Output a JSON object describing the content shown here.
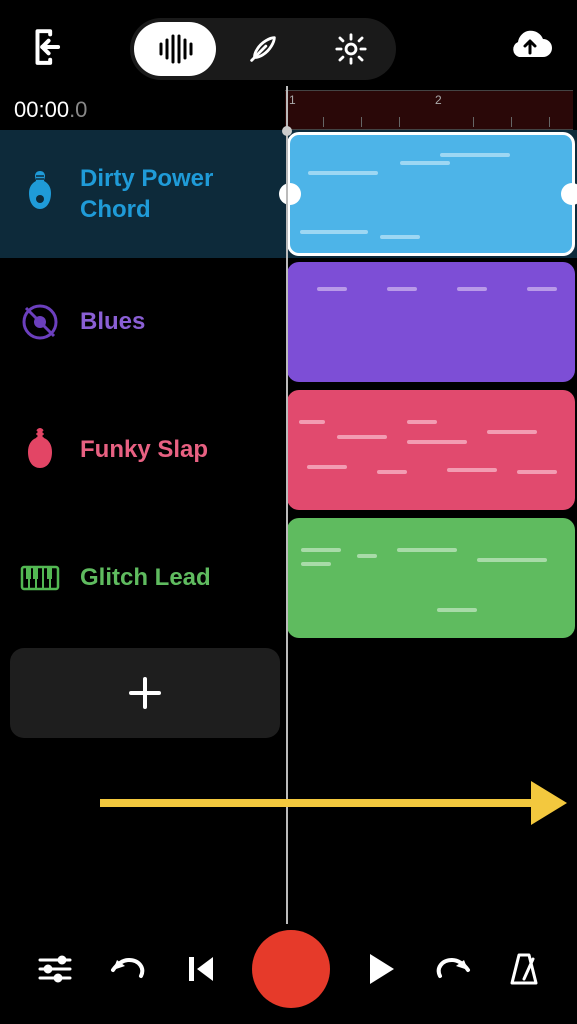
{
  "timecode": {
    "main": "00:00",
    "frac": ".0"
  },
  "ruler": {
    "markers": [
      "1",
      "2"
    ]
  },
  "tracks": [
    {
      "label": "Dirty Power Chord",
      "color": "#1f9bd8",
      "clipColor": "#4db4e8",
      "style": "guitar",
      "selected": true
    },
    {
      "label": "Blues",
      "color": "#6b3fbd",
      "clipColor": "#7d4ed6",
      "style": "drums",
      "selected": false
    },
    {
      "label": "Funky Slap",
      "color": "#e34565",
      "clipColor": "#e14a6e",
      "style": "bass",
      "selected": false
    },
    {
      "label": "Glitch Lead",
      "color": "#53b853",
      "clipColor": "#5fbb5f",
      "style": "keys",
      "selected": false
    }
  ],
  "icons": {
    "exit": "exit-icon",
    "sound": "soundwave-icon",
    "feather": "feather-icon",
    "settings": "gear-icon",
    "upload": "cloud-upload-icon",
    "plus": "plus-icon",
    "mixer": "sliders-icon",
    "undo": "undo-icon",
    "prev": "skip-back-icon",
    "record": "record-icon",
    "play": "play-icon",
    "redo": "redo-icon",
    "metronome": "metronome-icon"
  }
}
